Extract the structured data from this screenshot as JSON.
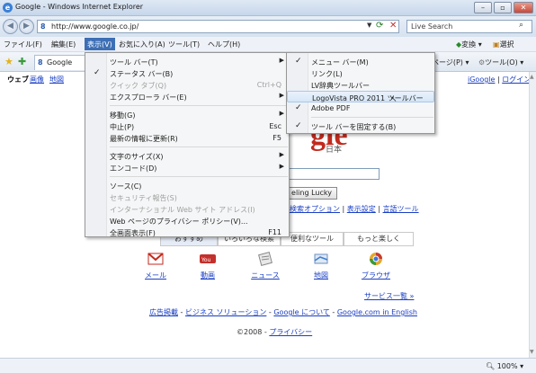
{
  "window": {
    "title": "Google - Windows Internet Explorer",
    "url": "http://www.google.co.jp/",
    "search_placeholder": "Live Search"
  },
  "menubar": {
    "items": [
      "ファイル(F)",
      "編集(E)",
      "表示(V)",
      "お気に入り(A)",
      "ツール(T)",
      "ヘルプ(H)"
    ],
    "right": [
      "変換",
      "選択"
    ]
  },
  "tabbar": {
    "tab_title": "Google",
    "commands": [
      "ページ(P)",
      "ツール(O)"
    ]
  },
  "view_menu": {
    "items": [
      {
        "label": "ツール バー(T)",
        "shortcut": "",
        "submenu": true,
        "checked": false,
        "disabled": false
      },
      {
        "label": "ステータス バー(B)",
        "shortcut": "",
        "submenu": false,
        "checked": true,
        "disabled": false
      },
      {
        "label": "クイック タブ(Q)",
        "shortcut": "Ctrl+Q",
        "submenu": false,
        "checked": false,
        "disabled": true
      },
      {
        "label": "エクスプローラ バー(E)",
        "shortcut": "",
        "submenu": true,
        "checked": false,
        "disabled": false
      },
      {
        "label": "移動(G)",
        "shortcut": "",
        "submenu": true,
        "checked": false,
        "disabled": false
      },
      {
        "label": "中止(P)",
        "shortcut": "Esc",
        "submenu": false,
        "checked": false,
        "disabled": false
      },
      {
        "label": "最新の情報に更新(R)",
        "shortcut": "F5",
        "submenu": false,
        "checked": false,
        "disabled": false
      },
      {
        "label": "文字のサイズ(X)",
        "shortcut": "",
        "submenu": true,
        "checked": false,
        "disabled": false
      },
      {
        "label": "エンコード(D)",
        "shortcut": "",
        "submenu": true,
        "checked": false,
        "disabled": false
      },
      {
        "label": "ソース(C)",
        "shortcut": "",
        "submenu": false,
        "checked": false,
        "disabled": false
      },
      {
        "label": "セキュリティ報告(S)",
        "shortcut": "",
        "submenu": false,
        "checked": false,
        "disabled": true
      },
      {
        "label": "インターナショナル Web サイト アドレス(I)",
        "shortcut": "",
        "submenu": false,
        "checked": false,
        "disabled": true
      },
      {
        "label": "Web ページのプライバシー ポリシー(V)...",
        "shortcut": "",
        "submenu": false,
        "checked": false,
        "disabled": false
      },
      {
        "label": "全画面表示(F)",
        "shortcut": "F11",
        "submenu": false,
        "checked": false,
        "disabled": false
      }
    ]
  },
  "toolbar_submenu": {
    "items": [
      {
        "label": "メニュー バー(M)",
        "checked": true,
        "highlighted": false
      },
      {
        "label": "リンク(L)",
        "checked": false,
        "highlighted": false
      },
      {
        "label": "LV辞典ツールバー",
        "checked": false,
        "highlighted": false
      },
      {
        "label": "LogoVista PRO 2011 ツールバー",
        "checked": false,
        "highlighted": true
      },
      {
        "label": "Adobe PDF",
        "checked": true,
        "highlighted": false
      },
      {
        "label": "ツール バーを固定する(B)",
        "checked": true,
        "highlighted": false
      }
    ]
  },
  "page": {
    "top_left": [
      "ウェブ",
      "画像",
      "地図"
    ],
    "top_right": [
      "iGoogle",
      "ログイン"
    ],
    "logo_sub": "日本",
    "lucky_button": "eling Lucky",
    "adv_links": [
      "検索オプション",
      "表示設定",
      "言語ツール"
    ],
    "tabs": [
      "おすすめ",
      "いろいろな検索",
      "便利なツール",
      "もっと楽しく"
    ],
    "services": [
      {
        "label": "メール",
        "icon": "gmail-icon"
      },
      {
        "label": "動画",
        "icon": "youtube-icon"
      },
      {
        "label": "ニュース",
        "icon": "news-icon"
      },
      {
        "label": "地図",
        "icon": "maps-icon"
      },
      {
        "label": "ブラウザ",
        "icon": "chrome-icon"
      }
    ],
    "all_services": "サービス一覧 »",
    "footer_links": [
      "広告掲載",
      "ビジネス ソリューション",
      "Google について",
      "Google.com in English"
    ],
    "copyright": "©2008 - ",
    "privacy": "プライバシー"
  },
  "status": {
    "zoom": "100%"
  }
}
